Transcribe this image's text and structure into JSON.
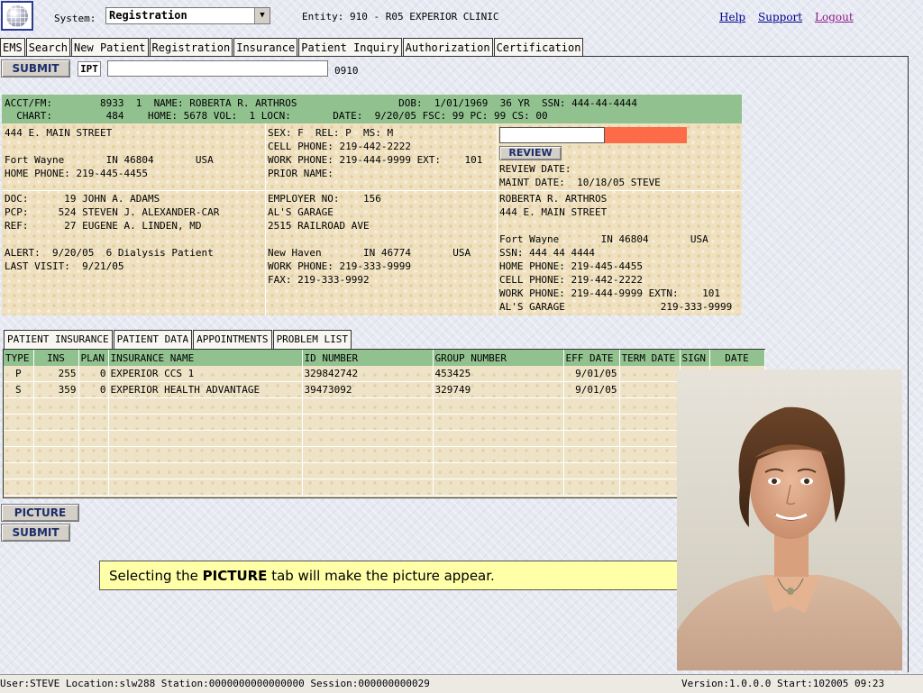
{
  "header": {
    "system_label": "System:",
    "system_value": "Registration",
    "entity_text": "Entity: 910 - R05 EXPERIOR CLINIC",
    "links": {
      "help": "Help",
      "support": "Support",
      "logout": "Logout"
    }
  },
  "tabs": [
    "EMS",
    "Search",
    "New Patient",
    "Registration",
    "Insurance",
    "Patient Inquiry",
    "Authorization",
    "Certification"
  ],
  "toolbar": {
    "submit_label": "SUBMIT",
    "ipt_label": "IPT",
    "ipt_value": "",
    "code": "0910"
  },
  "patient": {
    "head_line1": "ACCT/FM:        8933  1  NAME: ROBERTA R. ARTHROS                 DOB:  1/01/1969  36 YR  SSN: 444-44-4444",
    "head_line2": "  CHART:         484    HOME: 5678 VOL:  1 LOCN:       DATE:  9/20/05 FSC: 99 PC: 99 CS: 00",
    "address": {
      "street": "444 E. MAIN STREET",
      "city_line": "Fort Wayne       IN 46804       USA",
      "home_phone": "HOME PHONE: 219-445-4455"
    },
    "demo": {
      "sex_line": "SEX: F  REL: P  MS: M",
      "cell_phone": "CELL PHONE: 219-442-2222",
      "work_phone": "WORK PHONE: 219-444-9999 EXT:    101",
      "prior_name": "PRIOR NAME:"
    },
    "review": {
      "button": "REVIEW",
      "review_date": "REVIEW DATE:",
      "maint_date": "MAINT DATE:  10/18/05 STEVE"
    },
    "providers": {
      "doc": "DOC:      19 JOHN A. ADAMS",
      "pcp": "PCP:     524 STEVEN J. ALEXANDER-CAR",
      "ref": "REF:      27 EUGENE A. LINDEN, MD",
      "alert": "ALERT:  9/20/05  6 Dialysis Patient",
      "last_visit": "LAST VISIT:  9/21/05"
    },
    "employer": {
      "employer_no": "EMPLOYER NO:    156",
      "name": "AL'S GARAGE",
      "street": "2515 RAILROAD AVE",
      "city_line": "New Haven       IN 46774       USA",
      "work_phone": "WORK PHONE: 219-333-9999",
      "fax": "FAX: 219-333-9992"
    },
    "guarantor": {
      "name": "ROBERTA R. ARTHROS",
      "street": "444 E. MAIN STREET",
      "city_line": "Fort Wayne       IN 46804       USA",
      "ssn": "SSN: 444 44 4444",
      "home_phone": "HOME PHONE: 219-445-4455",
      "cell_phone": "CELL PHONE: 219-442-2222",
      "work_phone": "WORK PHONE: 219-444-9999 EXTN:    101",
      "employer": "AL'S GARAGE                219-333-9999"
    }
  },
  "subtabs": [
    "PATIENT INSURANCE",
    "PATIENT DATA",
    "APPOINTMENTS",
    "PROBLEM LIST"
  ],
  "insurance": {
    "columns": [
      "TYPE",
      "INS",
      "PLAN",
      "INSURANCE NAME",
      "ID NUMBER",
      "GROUP NUMBER",
      "EFF DATE",
      "TERM DATE",
      "SIGN",
      "DATE"
    ],
    "rows": [
      [
        "P",
        "255",
        "0",
        "EXPERIOR CCS 1",
        "329842742",
        "453425",
        "9/01/05",
        "",
        "",
        ""
      ],
      [
        "S",
        "359",
        "0",
        "EXPERIOR HEALTH ADVANTAGE",
        "39473092",
        "329749",
        "9/01/05",
        "",
        "",
        ""
      ]
    ]
  },
  "buttons": {
    "picture": "PICTURE",
    "submit": "SUBMIT"
  },
  "tooltip": {
    "prefix": "Selecting the ",
    "bold": "PICTURE",
    "suffix": " tab will make the picture appear."
  },
  "status": {
    "left": "User:STEVE Location:slw288 Station:0000000000000000 Session:000000000029",
    "right": "Version:1.0.0.0  Start:102005 09:23"
  },
  "colors": {
    "header_green": "#91c18f",
    "card_tan": "#efe1bf",
    "alert_red": "#fe6b48",
    "tooltip_yellow": "#ffffa8"
  }
}
